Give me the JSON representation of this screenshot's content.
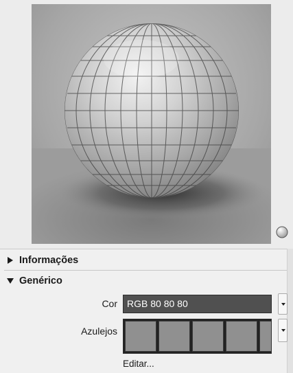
{
  "preview": {
    "background_color": "#9a9a9a",
    "sphere_icon": "sphere-preview-icon",
    "toggle_icon": "render-toggle-icon"
  },
  "sections": {
    "info": {
      "label": "Informações",
      "expanded": false
    },
    "generic": {
      "label": "Genérico",
      "expanded": true
    }
  },
  "color_field": {
    "label": "Cor",
    "value": "RGB 80 80 80",
    "swatch_color": "#505050"
  },
  "tiles_field": {
    "label": "Azulejos",
    "tile_color": "#909090",
    "tile_count": 5
  },
  "edit_link": "Editar..."
}
